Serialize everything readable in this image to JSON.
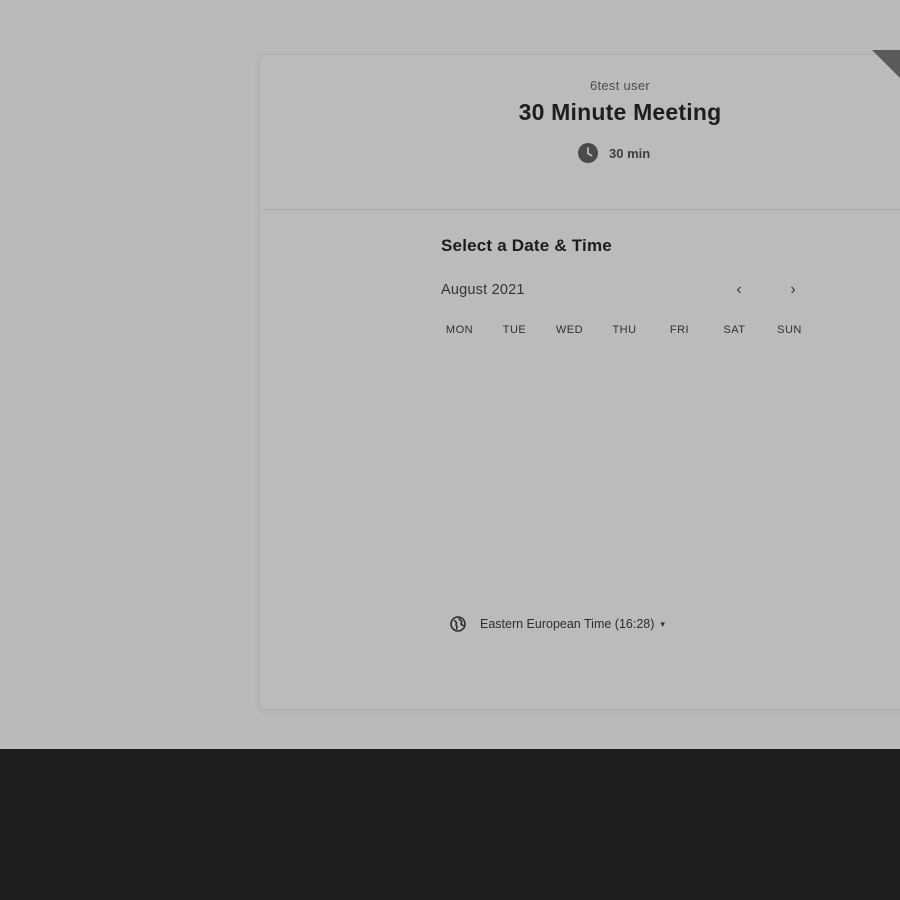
{
  "event": {
    "host": "6test user",
    "title": "30 Minute Meeting",
    "duration": "30 min",
    "duration_icon": "clock-icon"
  },
  "calendar": {
    "section_title": "Select a Date & Time",
    "month": "August 2021",
    "prev_icon": "‹",
    "next_icon": "›",
    "weekdays": [
      "MON",
      "TUE",
      "WED",
      "THU",
      "FRI",
      "SAT",
      "SUN"
    ]
  },
  "timezone": {
    "label": "Eastern European Time (16:28)",
    "icon": "globe-icon",
    "caret": "▾"
  },
  "colors": {
    "backdrop": "#bababa",
    "card": "#bbbbbb",
    "footer": "#1f1f1f",
    "ribbon": "#5a5a5a"
  }
}
